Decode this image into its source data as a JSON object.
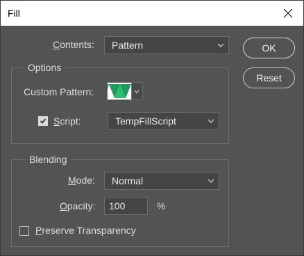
{
  "window": {
    "title": "Fill"
  },
  "contents": {
    "label_prefix": "",
    "label_mnemonic": "C",
    "label_rest": "ontents:",
    "value": "Pattern"
  },
  "buttons": {
    "ok": "OK",
    "reset": "Reset"
  },
  "options": {
    "title": "Options",
    "custom_pattern_label": "Custom Pattern:",
    "script": {
      "checked": true,
      "label_mnemonic": "S",
      "label_rest": "cript:",
      "value": "TempFillScript"
    }
  },
  "blending": {
    "title": "Blending",
    "mode": {
      "label_mnemonic": "M",
      "label_rest": "ode:",
      "value": "Normal"
    },
    "opacity": {
      "label_mnemonic": "O",
      "label_rest": "pacity:",
      "value": "100",
      "unit": "%"
    },
    "preserve_transparency": {
      "checked": false,
      "label_mnemonic": "P",
      "label_rest": "reserve Transparency"
    }
  },
  "colors": {
    "dialog_bg": "#535353",
    "pattern_green": "#1f9a5a"
  },
  "icons": {
    "close": "close-icon",
    "chevron": "chevron-down-icon",
    "check": "check-icon"
  }
}
